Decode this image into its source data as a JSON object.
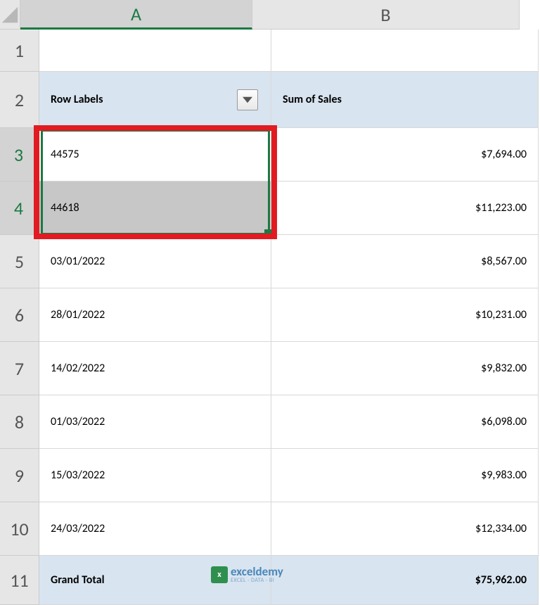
{
  "columns": {
    "A": "A",
    "B": "B"
  },
  "row_numbers": [
    "1",
    "2",
    "3",
    "4",
    "5",
    "6",
    "7",
    "8",
    "9",
    "10",
    "11"
  ],
  "header": {
    "row_labels": "Row Labels",
    "sum_of_sales": "Sum of Sales"
  },
  "rows": [
    {
      "label": "44575",
      "value": "$7,694.00"
    },
    {
      "label": "44618",
      "value": "$11,223.00"
    },
    {
      "label": "03/01/2022",
      "value": "$8,567.00"
    },
    {
      "label": "28/01/2022",
      "value": "$10,231.00"
    },
    {
      "label": "14/02/2022",
      "value": "$9,832.00"
    },
    {
      "label": "01/03/2022",
      "value": "$6,098.00"
    },
    {
      "label": "15/03/2022",
      "value": "$9,983.00"
    },
    {
      "label": "24/03/2022",
      "value": "$12,334.00"
    }
  ],
  "totals": {
    "label": "Grand Total",
    "value": "$75,962.00"
  },
  "watermark": {
    "main": "exceldemy",
    "sub": "EXCEL · DATA · BI"
  },
  "selection": {
    "range": "A3:A4",
    "highlight": "A3:A4"
  }
}
